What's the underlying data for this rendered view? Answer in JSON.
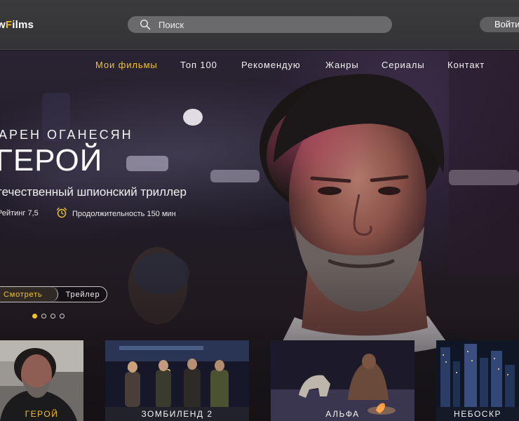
{
  "app": {
    "logo_prefix": "w",
    "logo_highlight": "F",
    "logo_suffix": "ilms",
    "accent_color": "#f2c12e"
  },
  "search": {
    "placeholder": "Поиск",
    "icon": "search-icon"
  },
  "header": {
    "login_label": "Войти"
  },
  "nav": {
    "items": [
      "Мои фильмы",
      "Топ 100",
      "Рекомендую",
      "Жанры",
      "Сериалы",
      "Контакт"
    ],
    "active_index": 0
  },
  "hero": {
    "director": "АРЕН ОГАНЕСЯН",
    "title": "ГЕРОЙ",
    "subtitle": "течественный шпионский триллер",
    "rating": "Рейтинг 7,5",
    "duration": "Продолжительность 150 мин",
    "duration_icon": "alarm-clock-icon",
    "watch_label": "Смотреть",
    "trailer_label": "Трейлер",
    "slides_total": 4,
    "slide_active": 1
  },
  "cards": [
    {
      "caption": "ГЕРОЙ",
      "active": true
    },
    {
      "caption": "ЗОМБИЛЕНД 2",
      "active": false
    },
    {
      "caption": "АЛЬФА",
      "active": false
    },
    {
      "caption": "НЕБОСКР",
      "active": false
    }
  ]
}
